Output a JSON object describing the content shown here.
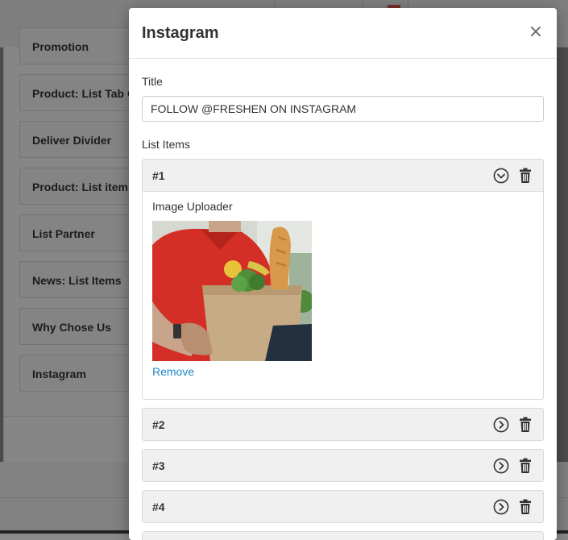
{
  "background": {
    "items": [
      "Promotion",
      "Product: List Tab Ca",
      "Deliver Divider",
      "Product: List item",
      "List Partner",
      "News: List Items",
      "Why Chose Us",
      "Instagram"
    ]
  },
  "modal": {
    "title": "Instagram",
    "close_label": "×",
    "title_field": {
      "label": "Title",
      "value": "FOLLOW @FRESHEN ON INSTAGRAM"
    },
    "list_label": "List Items",
    "items": [
      {
        "label": "#1",
        "expanded": true,
        "uploader_label": "Image Uploader",
        "remove_label": "Remove"
      },
      {
        "label": "#2",
        "expanded": false
      },
      {
        "label": "#3",
        "expanded": false
      },
      {
        "label": "#4",
        "expanded": false
      }
    ]
  },
  "icons": {
    "toggle_open": "chevron-down-circle-icon",
    "toggle_closed": "chevron-right-circle-icon",
    "delete": "trash-icon"
  },
  "colors": {
    "link": "#1e88c7",
    "header_bg": "#f0f0f0"
  }
}
